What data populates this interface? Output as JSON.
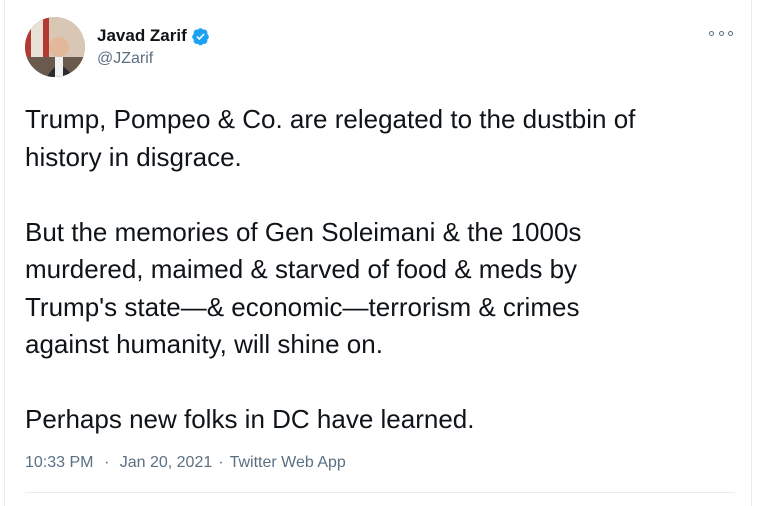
{
  "author": {
    "display_name": "Javad Zarif",
    "handle": "@JZarif",
    "verified": true,
    "avatar_icon": "profile-photo",
    "verified_icon": "verified-badge-icon"
  },
  "tweet": {
    "paragraphs": [
      [
        "Trump, Pompeo & Co. are relegated to the dustbin of",
        "history in disgrace."
      ],
      [
        "But the memories of Gen Soleimani & the 1000s",
        "murdered, maimed & starved of food & meds by",
        "Trump's state—& economic—terrorism & crimes",
        "against humanity, will shine on."
      ],
      [
        "Perhaps new folks in DC have learned."
      ]
    ]
  },
  "meta": {
    "time": "10:33 PM",
    "separator": "·",
    "date": "Jan 20, 2021",
    "source": "Twitter Web App"
  },
  "colors": {
    "text": "#0f1419",
    "secondary": "#5b7083",
    "verified": "#1da1f2",
    "border": "#e6ecf0"
  }
}
